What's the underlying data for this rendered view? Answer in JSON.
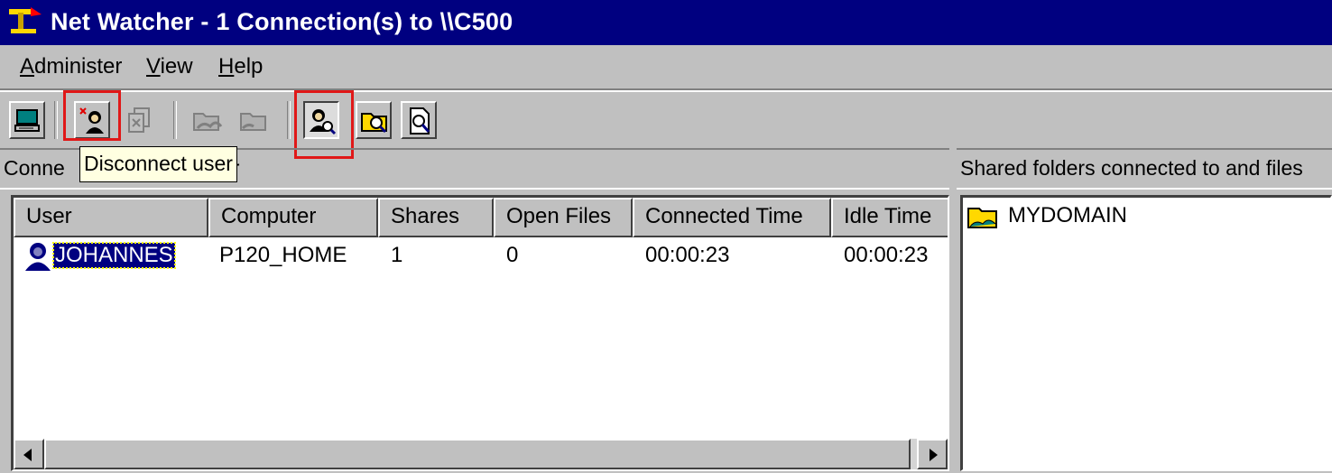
{
  "window": {
    "title": "Net Watcher - 1 Connection(s) to \\\\C500",
    "title_icon": "net-watcher-icon"
  },
  "menubar": {
    "items": [
      {
        "label": "Administer",
        "mnemonic": "A"
      },
      {
        "label": "View",
        "mnemonic": "V"
      },
      {
        "label": "Help",
        "mnemonic": "H"
      }
    ]
  },
  "toolbar": {
    "buttons": [
      {
        "icon": "select-server-icon",
        "enabled": true
      },
      {
        "icon": "disconnect-user-icon",
        "enabled": true,
        "highlighted": true
      },
      {
        "icon": "close-file-icon",
        "enabled": false
      },
      {
        "icon": "add-share-icon",
        "enabled": false
      },
      {
        "icon": "stop-sharing-icon",
        "enabled": false
      },
      {
        "icon": "show-users-icon",
        "enabled": true,
        "pressed": true,
        "highlighted": true
      },
      {
        "icon": "show-shared-folders-icon",
        "enabled": true
      },
      {
        "icon": "show-files-icon",
        "enabled": true
      }
    ],
    "tooltip": "Disconnect user"
  },
  "left_panel": {
    "header_prefix": "Conne",
    "header_suffix": "r",
    "columns": [
      "User",
      "Computer",
      "Shares",
      "Open Files",
      "Connected Time",
      "Idle Time"
    ],
    "rows": [
      {
        "user": "JOHANNES",
        "computer": "P120_HOME",
        "shares": "1",
        "open_files": "0",
        "connected_time": "00:00:23",
        "idle_time": "00:00:23",
        "selected": true,
        "icon": "user-icon"
      }
    ]
  },
  "right_panel": {
    "header": "Shared folders connected to and files",
    "items": [
      {
        "label": "MYDOMAIN",
        "icon": "shared-folder-icon"
      }
    ]
  },
  "colors": {
    "title_bar": "#000080",
    "selection": "#000080",
    "highlight_box": "#e01818",
    "tooltip_bg": "#ffffe1"
  }
}
